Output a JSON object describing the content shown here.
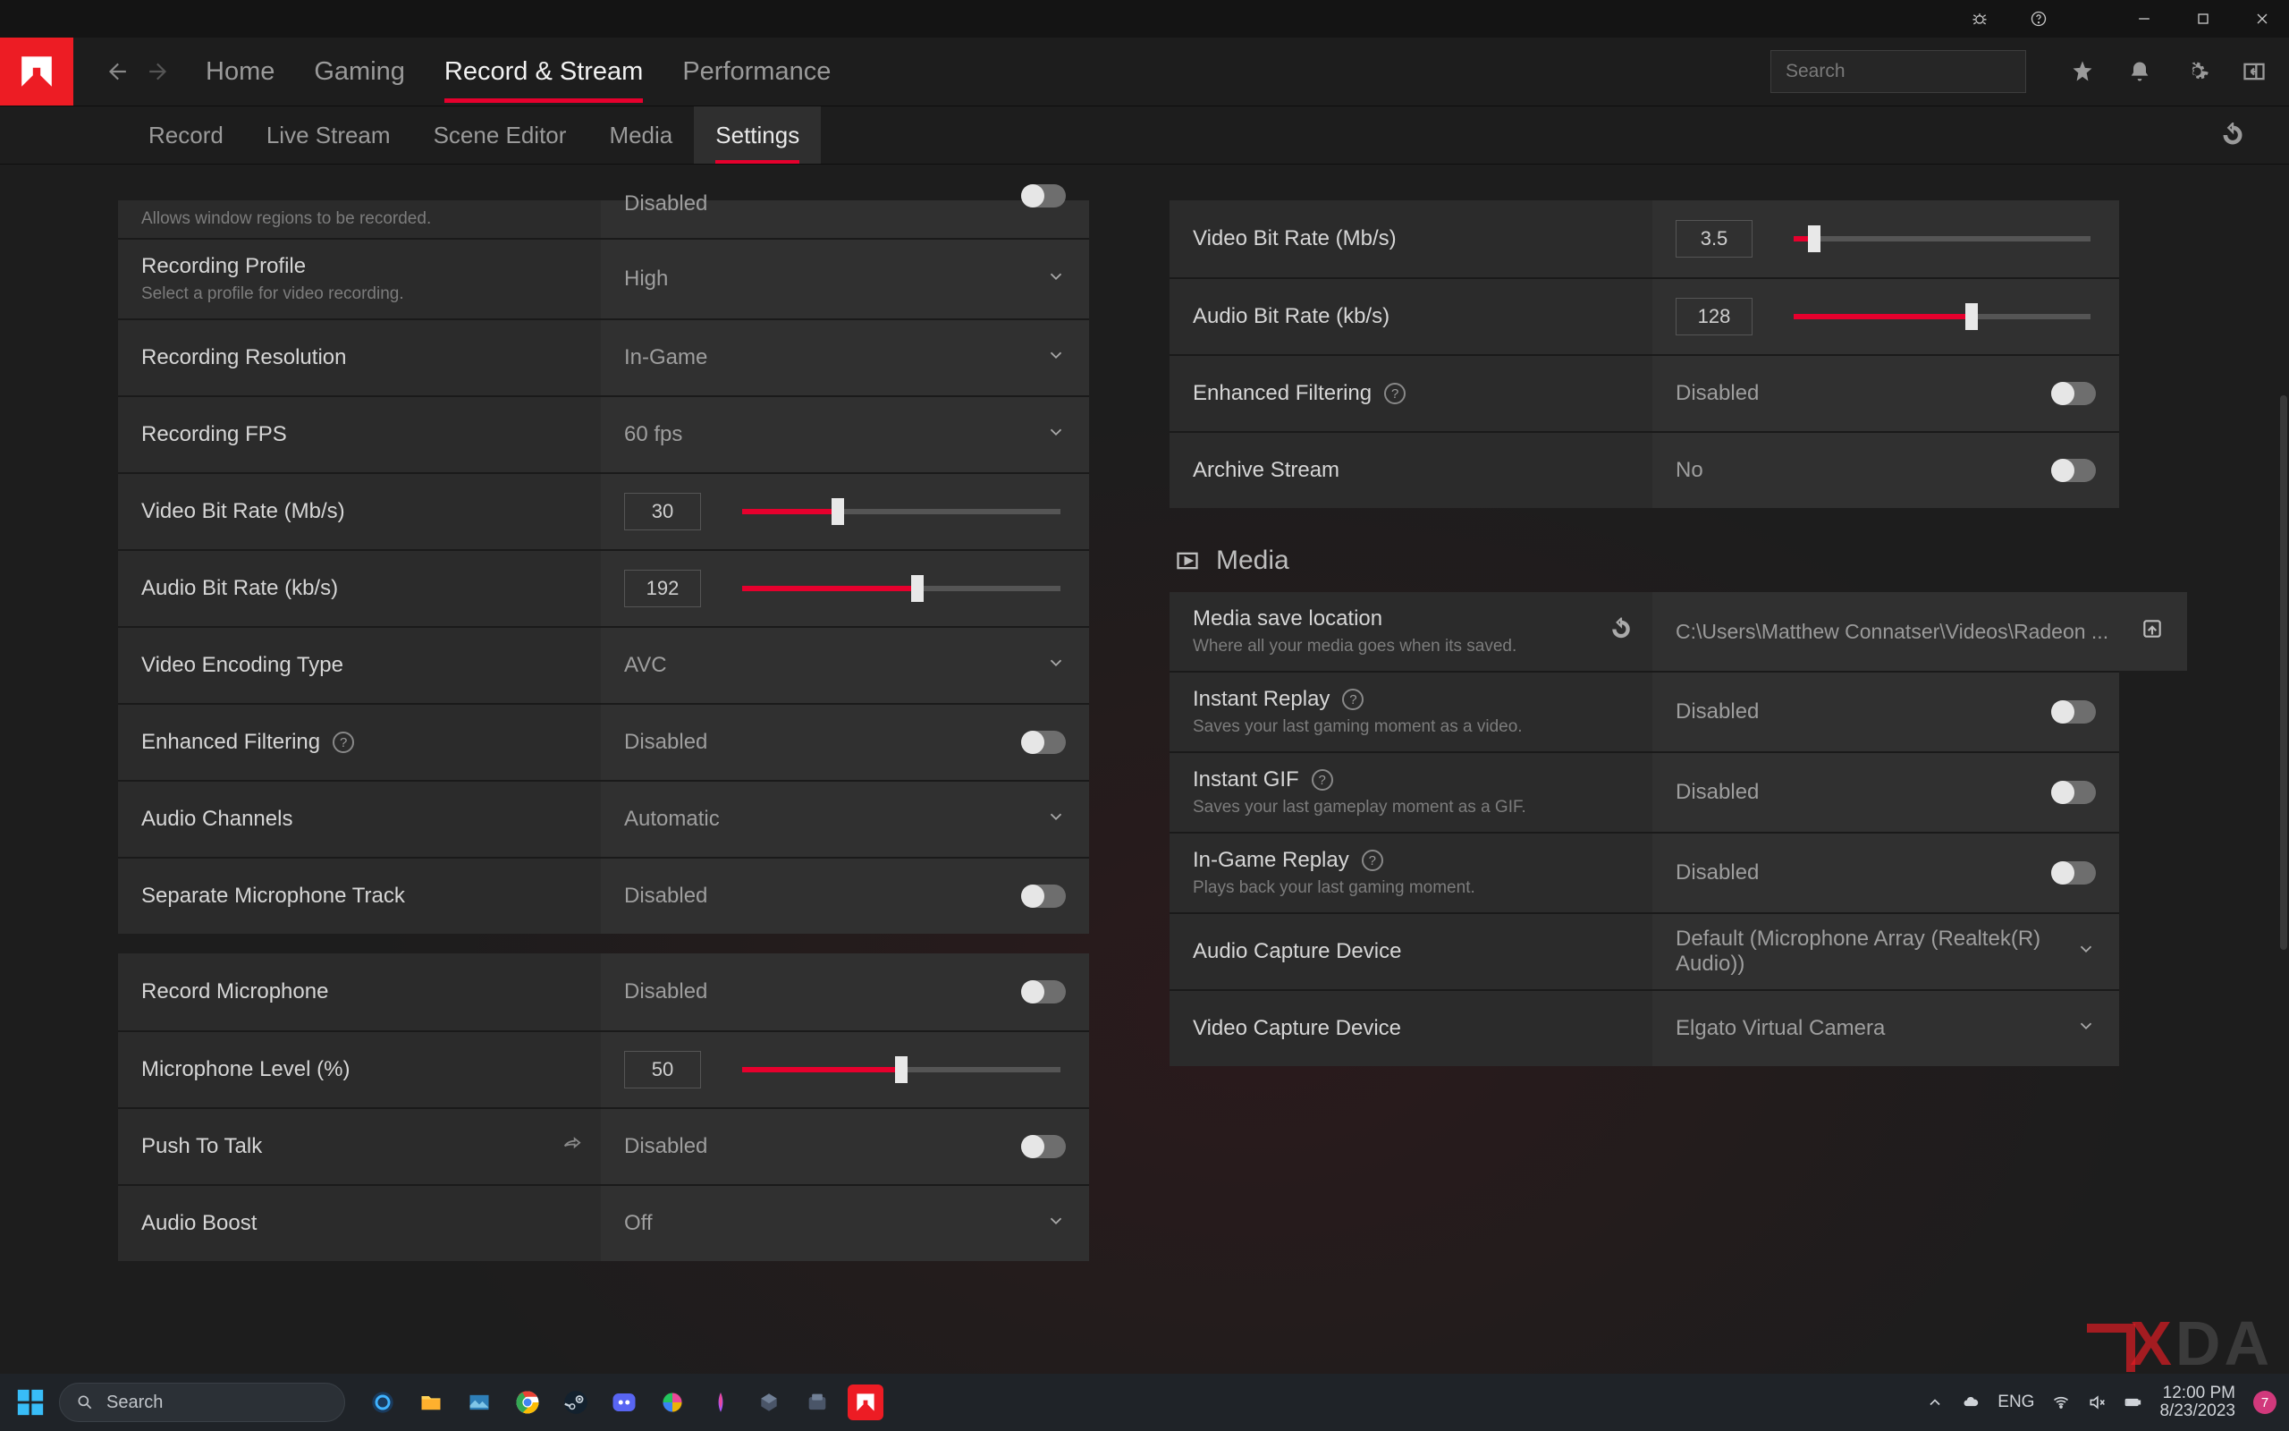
{
  "titlebar": {
    "icons": [
      "bug",
      "help",
      "minimize",
      "maximize",
      "close"
    ]
  },
  "nav": {
    "items": [
      "Home",
      "Gaming",
      "Record & Stream",
      "Performance"
    ],
    "active": 2
  },
  "search": {
    "placeholder": "Search"
  },
  "subnav": {
    "items": [
      "Record",
      "Live Stream",
      "Scene Editor",
      "Media",
      "Settings"
    ],
    "active": 4
  },
  "left": {
    "clip": {
      "sub": "Allows window regions to be recorded.",
      "value": "Disabled"
    },
    "rows": [
      {
        "label": "Recording Profile",
        "sub": "Select a profile for video recording.",
        "value": "High",
        "type": "dropdown"
      },
      {
        "label": "Recording Resolution",
        "value": "In-Game",
        "type": "dropdown"
      },
      {
        "label": "Recording FPS",
        "value": "60 fps",
        "type": "dropdown"
      },
      {
        "label": "Video Bit Rate (Mb/s)",
        "num": "30",
        "type": "slider",
        "fill": 30
      },
      {
        "label": "Audio Bit Rate (kb/s)",
        "num": "192",
        "type": "slider",
        "fill": 55
      },
      {
        "label": "Video Encoding Type",
        "value": "AVC",
        "type": "dropdown"
      },
      {
        "label": "Enhanced Filtering",
        "help": true,
        "value": "Disabled",
        "type": "toggle",
        "on": false
      },
      {
        "label": "Audio Channels",
        "value": "Automatic",
        "type": "dropdown"
      },
      {
        "label": "Separate Microphone Track",
        "value": "Disabled",
        "type": "toggle",
        "on": false
      }
    ],
    "rows2": [
      {
        "label": "Record Microphone",
        "value": "Disabled",
        "type": "toggle",
        "on": false
      },
      {
        "label": "Microphone Level (%)",
        "num": "50",
        "type": "slider",
        "fill": 50
      },
      {
        "label": "Push To Talk",
        "share": true,
        "value": "Disabled",
        "type": "toggle",
        "on": false
      },
      {
        "label": "Audio Boost",
        "value": "Off",
        "type": "dropdown"
      }
    ]
  },
  "right": {
    "rows": [
      {
        "label": "Video Bit Rate (Mb/s)",
        "num": "3.5",
        "type": "slider",
        "fill": 7
      },
      {
        "label": "Audio Bit Rate (kb/s)",
        "num": "128",
        "type": "slider",
        "fill": 60
      },
      {
        "label": "Enhanced Filtering",
        "help": true,
        "value": "Disabled",
        "type": "toggle",
        "on": false
      },
      {
        "label": "Archive Stream",
        "value": "No",
        "type": "toggle",
        "on": false
      }
    ],
    "section": "Media",
    "mediaRows": [
      {
        "label": "Media save location",
        "sub": "Where all your media goes when its saved.",
        "value": "C:\\Users\\Matthew Connatser\\Videos\\Radeon ...",
        "type": "path"
      },
      {
        "label": "Instant Replay",
        "help": true,
        "sub": "Saves your last gaming moment as a video.",
        "value": "Disabled",
        "type": "toggle",
        "on": false
      },
      {
        "label": "Instant GIF",
        "help": true,
        "sub": "Saves your last gameplay moment as a GIF.",
        "value": "Disabled",
        "type": "toggle",
        "on": false
      },
      {
        "label": "In-Game Replay",
        "help": true,
        "sub": "Plays back your last gaming moment.",
        "value": "Disabled",
        "type": "toggle",
        "on": false
      },
      {
        "label": "Audio Capture Device",
        "value": "Default (Microphone Array (Realtek(R) Audio))",
        "type": "dropdown"
      },
      {
        "label": "Video Capture Device",
        "value": "Elgato Virtual Camera",
        "type": "dropdown"
      }
    ]
  },
  "taskbar": {
    "search": "Search",
    "lang": "ENG",
    "time": "12:00 PM",
    "date": "8/23/2023",
    "notif": "7"
  }
}
